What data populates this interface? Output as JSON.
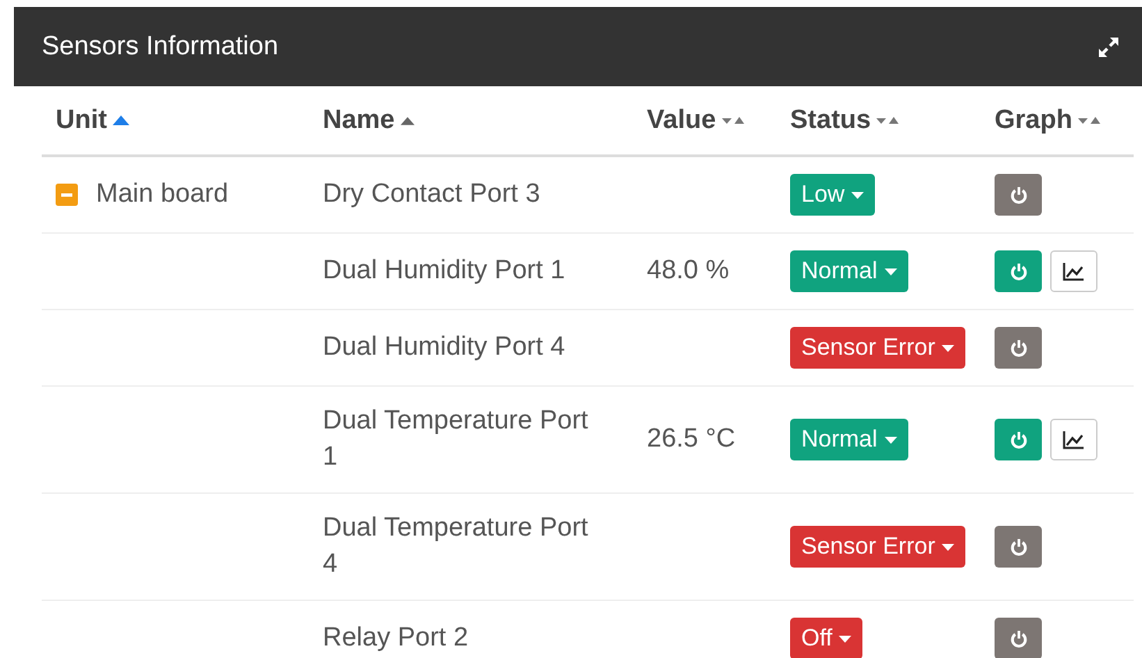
{
  "panel": {
    "title": "Sensors Information"
  },
  "table": {
    "columns": [
      {
        "label": "Unit",
        "sorted": true,
        "selected": true
      },
      {
        "label": "Name",
        "sorted": true,
        "selected": false
      },
      {
        "label": "Value",
        "sorted": false,
        "selected": false
      },
      {
        "label": "Status",
        "sorted": false,
        "selected": false
      },
      {
        "label": "Graph",
        "sorted": false,
        "selected": false
      }
    ],
    "rows": [
      {
        "unit": "Main board",
        "expanded": true,
        "name": "Dry Contact Port 3",
        "status": "Low",
        "color": "#10a37f",
        "on": false,
        "graph": false
      },
      {
        "name": "Dual Humidity Port 1",
        "value": "48.0 %",
        "status": "Normal",
        "color": "#10a37f",
        "on": true,
        "graph": true
      },
      {
        "name": "Dual Humidity Port 4",
        "status": "Sensor Error",
        "color": "#d93434",
        "on": false,
        "graph": false
      },
      {
        "name": "Dual Temperature Port 1",
        "value": "26.5 °C",
        "status": "Normal",
        "color": "#10a37f",
        "on": true,
        "graph": true
      },
      {
        "name": "Dual Temperature Port 4",
        "status": "Sensor Error",
        "color": "#d93434",
        "on": false,
        "graph": false
      },
      {
        "name": "Relay Port 2",
        "status": "Off",
        "color": "#d93434",
        "on": false,
        "graph": false
      }
    ]
  }
}
